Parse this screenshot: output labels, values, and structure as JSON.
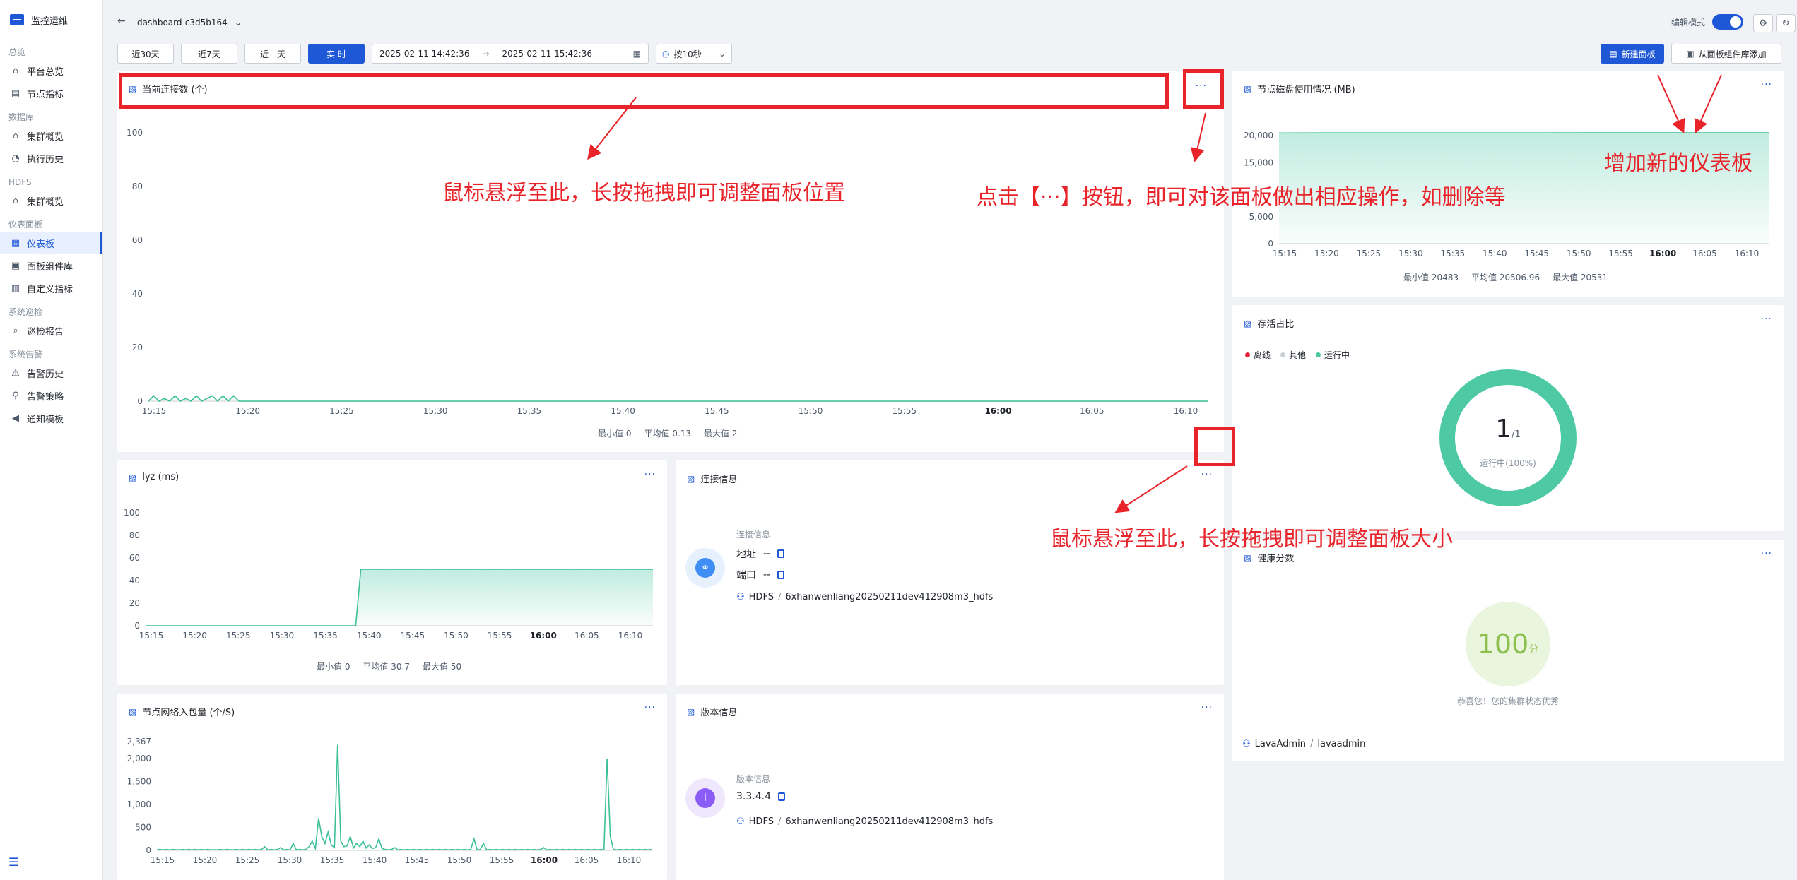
{
  "colors": {
    "accent": "#1e58d6",
    "teal": "#4dc9a4",
    "annotation": "#e8232a",
    "offline": "#e5243b",
    "other": "#c9cdd4",
    "score_bg": "#e9f5dc",
    "score_text": "#8dc04e",
    "link_icon_bg": "#e6f1fd",
    "version_icon_bg": "#efe7fb"
  },
  "sidebar": {
    "title": "监控运维",
    "groups": [
      {
        "title": "总览",
        "items": [
          {
            "label": "平台总览",
            "icon": "home-icon"
          },
          {
            "label": "节点指标",
            "icon": "chart-icon"
          }
        ]
      },
      {
        "title": "数据库",
        "items": [
          {
            "label": "集群概览",
            "icon": "home-icon"
          },
          {
            "label": "执行历史",
            "icon": "history-icon"
          }
        ]
      },
      {
        "title": "HDFS",
        "items": [
          {
            "label": "集群概览",
            "icon": "home-icon"
          }
        ]
      },
      {
        "title": "仪表面板",
        "items": [
          {
            "label": "仪表板",
            "icon": "dashboard-icon",
            "active": true
          },
          {
            "label": "面板组件库",
            "icon": "library-icon"
          },
          {
            "label": "自定义指标",
            "icon": "metric-icon"
          }
        ]
      },
      {
        "title": "系统巡检",
        "items": [
          {
            "label": "巡检报告",
            "icon": "search-icon"
          }
        ]
      },
      {
        "title": "系统告警",
        "items": [
          {
            "label": "告警历史",
            "icon": "alert-icon"
          },
          {
            "label": "告警策略",
            "icon": "location-icon"
          },
          {
            "label": "通知模板",
            "icon": "speaker-icon"
          }
        ]
      }
    ]
  },
  "header": {
    "dashboard_name": "dashboard-c3d5b164",
    "edit_mode_label": "编辑模式"
  },
  "toolbar": {
    "ranges": [
      {
        "label": "近30天"
      },
      {
        "label": "近7天"
      },
      {
        "label": "近一天"
      },
      {
        "label": "实 时",
        "active": true
      }
    ],
    "start_time": "2025-02-11 14:42:36",
    "end_time": "2025-02-11 15:42:36",
    "refresh": "按10秒",
    "new_panel": "新建面板",
    "add_from_library": "从面板组件库添加"
  },
  "panels": {
    "connections": {
      "title": "当前连接数 (个)",
      "stats": {
        "min": "最小值 0",
        "avg": "平均值 0.13",
        "max": "最大值 2"
      }
    },
    "disk": {
      "title": "节点磁盘使用情况 (MB)",
      "stats": {
        "min": "最小值 20483",
        "avg": "平均值 20506.96",
        "max": "最大值 20531"
      }
    },
    "lyz": {
      "title": "lyz (ms)",
      "stats": {
        "min": "最小值 0",
        "avg": "平均值 30.7",
        "max": "最大值 50"
      }
    },
    "conn_info": {
      "title": "连接信息",
      "section_label": "连接信息",
      "address_label": "地址",
      "address_value": "--",
      "port_label": "端口",
      "port_value": "--",
      "path_type": "HDFS",
      "path_sep": "/",
      "path_name": "6xhanwenliang20250211dev412908m3_hdfs"
    },
    "survival": {
      "title": "存活占比",
      "legend": [
        "离线",
        "其他",
        "运行中"
      ],
      "center_value": "1",
      "center_total": "/1",
      "center_label": "运行中(100%)"
    },
    "health": {
      "title": "健康分数",
      "score": "100",
      "unit": "分",
      "message": "恭喜您！您的集群状态优秀",
      "user": "LavaAdmin",
      "sep": "/",
      "account": "lavaadmin"
    },
    "network": {
      "title": "节点网络入包量 (个/S)"
    },
    "version": {
      "title": "版本信息",
      "section_label": "版本信息",
      "version": "3.3.4.4",
      "path_type": "HDFS",
      "path_sep": "/",
      "path_name": "6xhanwenliang20250211dev412908m3_hdfs"
    }
  },
  "annotations": {
    "drag_position": "鼠标悬浮至此，长按拖拽即可调整面板位置",
    "more_ops": "点击【···】按钮，即可对该面板做出相应操作，如删除等",
    "add_dashboard": "增加新的仪表板",
    "resize": "鼠标悬浮至此，长按拖拽即可调整面板大小"
  },
  "chart_data": [
    {
      "id": "connections",
      "type": "line",
      "title": "当前连接数 (个)",
      "x": [
        "15:15",
        "15:20",
        "15:25",
        "15:30",
        "15:35",
        "15:40",
        "15:45",
        "15:50",
        "15:55",
        "16:00",
        "16:05",
        "16:10"
      ],
      "ylim": [
        0,
        100
      ],
      "yticks": [
        0,
        20,
        40,
        60,
        80,
        100
      ],
      "series": [
        {
          "values": [
            0,
            2,
            0,
            1,
            0,
            2,
            0,
            1,
            0,
            2,
            0,
            1,
            2,
            0,
            2,
            0,
            2,
            0,
            0,
            0,
            0,
            0,
            0,
            0,
            0,
            0,
            0,
            0,
            0,
            0,
            0,
            0,
            0,
            0,
            0,
            0,
            0,
            0,
            0,
            0,
            0,
            0,
            0,
            0,
            0,
            0,
            0,
            0,
            0,
            0,
            0,
            0,
            0,
            0,
            0,
            0,
            0,
            0,
            0,
            0,
            0,
            0,
            0,
            0,
            0,
            0,
            0,
            0,
            0,
            0,
            0,
            0,
            0,
            0,
            0,
            0,
            0,
            0,
            0,
            0,
            0,
            0,
            0,
            0,
            0,
            0,
            0,
            0,
            0,
            0,
            0,
            0,
            0,
            0,
            0,
            0,
            0,
            0,
            0,
            0,
            0,
            0,
            0,
            0,
            0,
            0,
            0,
            0,
            0,
            0,
            0,
            0,
            0,
            0,
            0,
            0,
            0,
            0,
            0,
            0,
            0,
            0,
            0,
            0,
            0,
            0,
            0,
            0,
            0,
            0,
            0,
            0,
            0,
            0,
            0,
            0,
            0,
            0,
            0,
            0,
            0,
            0,
            0,
            0,
            0,
            0,
            0,
            0,
            0,
            0,
            0,
            0,
            0,
            0,
            0,
            0,
            0,
            0,
            0,
            0,
            0,
            0,
            0,
            0,
            0,
            0,
            0,
            0,
            0,
            0,
            0,
            0,
            0,
            0,
            0,
            0,
            0,
            0,
            0,
            0,
            0,
            0,
            0,
            0,
            0,
            0,
            0,
            0,
            0,
            0,
            0,
            0,
            0,
            0,
            0,
            0,
            0,
            0,
            0,
            0
          ]
        }
      ],
      "grid": false
    },
    {
      "id": "disk",
      "type": "area",
      "title": "节点磁盘使用情况 (MB)",
      "x": [
        "15:15",
        "15:20",
        "15:25",
        "15:30",
        "15:35",
        "15:40",
        "15:45",
        "15:50",
        "15:55",
        "16:00",
        "16:05",
        "16:10"
      ],
      "ylim": [
        0,
        20531
      ],
      "yticks": [
        0,
        5000,
        15000,
        20000
      ],
      "ytick_labels": [
        "0",
        "5,000",
        "15,000",
        "20,000"
      ],
      "series": [
        {
          "values": [
            20483,
            20500,
            20505,
            20507,
            20510,
            20512,
            20515,
            20518,
            20520,
            20525,
            20528,
            20531
          ]
        }
      ]
    },
    {
      "id": "lyz",
      "type": "area",
      "title": "lyz (ms)",
      "x": [
        "15:15",
        "15:20",
        "15:25",
        "15:30",
        "15:35",
        "15:40",
        "15:45",
        "15:50",
        "15:55",
        "16:00",
        "16:05",
        "16:10"
      ],
      "ylim": [
        0,
        100
      ],
      "yticks": [
        0,
        20,
        40,
        60,
        80,
        100
      ],
      "series": [
        {
          "values": [
            0,
            0,
            0,
            0,
            0,
            0,
            0,
            0,
            0,
            0,
            0,
            0,
            0,
            0,
            0,
            0,
            0,
            0,
            0,
            0,
            0,
            0,
            0,
            0,
            0,
            0,
            0,
            0,
            0,
            0,
            0,
            0,
            0,
            0,
            0,
            0,
            0,
            0,
            0,
            0,
            0,
            0,
            50,
            50,
            50,
            50,
            50,
            50,
            50,
            50,
            50,
            50,
            50,
            50,
            50,
            50,
            50,
            50,
            50,
            50,
            50,
            50,
            50,
            50,
            50,
            50,
            50,
            50,
            50,
            50,
            50,
            50,
            50,
            50,
            50,
            50,
            50,
            50,
            50,
            50,
            50,
            50,
            50,
            50,
            50,
            50,
            50,
            50,
            50,
            50,
            50,
            50,
            50,
            50,
            50,
            50,
            50,
            50,
            50,
            50
          ]
        }
      ]
    },
    {
      "id": "network",
      "type": "line",
      "title": "节点网络入包量 (个/S)",
      "x": [
        "15:15",
        "15:20",
        "15:25",
        "15:30",
        "15:35",
        "15:40",
        "15:45",
        "15:50",
        "15:55",
        "16:00",
        "16:05",
        "16:10"
      ],
      "ylim": [
        0,
        2367
      ],
      "yticks": [
        0,
        500,
        1000,
        1500,
        2000,
        2367
      ],
      "ytick_labels": [
        "0",
        "500",
        "1,000",
        "1,500",
        "2,000",
        "2,367"
      ],
      "series": [
        {
          "values": [
            10,
            20,
            10,
            20,
            10,
            20,
            15,
            10,
            20,
            10,
            20,
            10,
            20,
            10,
            20,
            10,
            20,
            10,
            15,
            10,
            20,
            10,
            20,
            15,
            10,
            20,
            10,
            20,
            10,
            20,
            10,
            20,
            10,
            20,
            80,
            10,
            20,
            10,
            20,
            60,
            10,
            20,
            10,
            150,
            10,
            20,
            10,
            20,
            80,
            200,
            40,
            700,
            300,
            150,
            400,
            120,
            60,
            2300,
            200,
            80,
            100,
            300,
            50,
            150,
            80,
            200,
            50,
            120,
            40,
            60,
            250,
            40,
            20,
            10,
            20,
            60,
            10,
            20,
            10,
            20,
            10,
            20,
            10,
            20,
            10,
            20,
            10,
            20,
            10,
            20,
            10,
            20,
            10,
            20,
            10,
            20,
            10,
            20,
            10,
            20,
            250,
            10,
            20,
            150,
            10,
            20,
            10,
            20,
            10,
            20,
            10,
            20,
            10,
            20,
            10,
            20,
            10,
            20,
            10,
            20,
            10,
            20,
            60,
            10,
            20,
            10,
            20,
            10,
            20,
            10,
            20,
            10,
            20,
            10,
            20,
            10,
            20,
            10,
            20,
            10,
            20,
            10,
            2000,
            300,
            20,
            10,
            20,
            10,
            20,
            10,
            20,
            10,
            20,
            10,
            20,
            10,
            20
          ]
        }
      ]
    },
    {
      "id": "survival",
      "type": "pie",
      "title": "存活占比",
      "categories": [
        "离线",
        "其他",
        "运行中"
      ],
      "values": [
        0,
        0,
        1
      ]
    }
  ]
}
